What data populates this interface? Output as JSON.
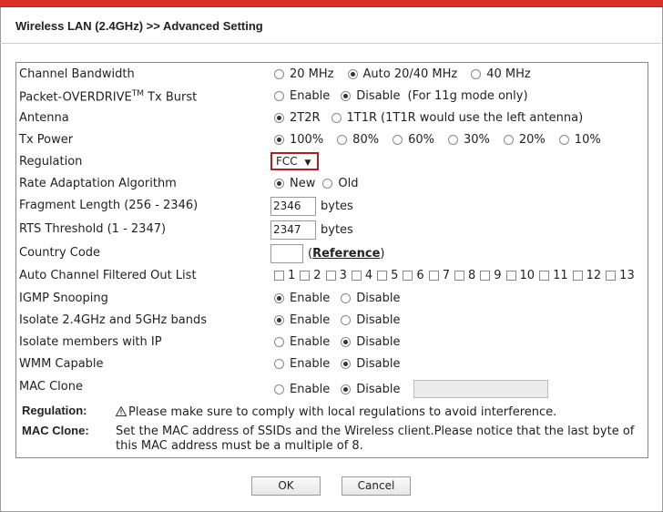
{
  "title": "Wireless LAN (2.4GHz) >> Advanced Setting",
  "rows": {
    "channel_bandwidth": {
      "label": "Channel Bandwidth",
      "options": [
        "20 MHz",
        "Auto 20/40 MHz",
        "40 MHz"
      ],
      "selected": "Auto 20/40 MHz"
    },
    "packet_overdrive": {
      "label_pre": "Packet-OVERDRIVE",
      "label_sup": "TM",
      "label_post": " Tx Burst",
      "options": [
        "Enable",
        "Disable"
      ],
      "selected": "Disable",
      "note": "(For 11g mode only)"
    },
    "antenna": {
      "label": "Antenna",
      "options": [
        "2T2R",
        "1T1R"
      ],
      "selected": "2T2R",
      "note": "(1T1R would use the left antenna)"
    },
    "tx_power": {
      "label": "Tx Power",
      "options": [
        "100%",
        "80%",
        "60%",
        "30%",
        "20%",
        "10%"
      ],
      "selected": "100%"
    },
    "regulation": {
      "label": "Regulation",
      "value": "FCC",
      "arrow": "▼"
    },
    "rate_adaptation": {
      "label": "Rate Adaptation Algorithm",
      "options": [
        "New",
        "Old"
      ],
      "selected": "New"
    },
    "fragment_length": {
      "label": "Fragment Length (256 - 2346)",
      "value": "2346",
      "unit": "bytes"
    },
    "rts_threshold": {
      "label": "RTS Threshold (1 - 2347)",
      "value": "2347",
      "unit": "bytes"
    },
    "country_code": {
      "label": "Country Code",
      "value": "",
      "link_open": "(",
      "link": "Reference",
      "link_close": ")"
    },
    "auto_channel": {
      "label": "Auto Channel Filtered Out List",
      "channels": [
        "1",
        "2",
        "3",
        "4",
        "5",
        "6",
        "7",
        "8",
        "9",
        "10",
        "11",
        "12",
        "13"
      ]
    },
    "igmp_snooping": {
      "label": "IGMP Snooping",
      "options": [
        "Enable",
        "Disable"
      ],
      "selected": "Enable"
    },
    "isolate_bands": {
      "label": "Isolate 2.4GHz and 5GHz bands",
      "options": [
        "Enable",
        "Disable"
      ],
      "selected": "Enable"
    },
    "isolate_ip": {
      "label": "Isolate members with IP",
      "options": [
        "Enable",
        "Disable"
      ],
      "selected": "Disable"
    },
    "wmm": {
      "label": "WMM Capable",
      "options": [
        "Enable",
        "Disable"
      ],
      "selected": "Disable"
    },
    "mac_clone": {
      "label": "MAC Clone",
      "options": [
        "Enable",
        "Disable"
      ],
      "selected": "Disable",
      "value": ""
    }
  },
  "notes": {
    "regulation_label": "Regulation:",
    "regulation_icon": "warning-icon",
    "regulation_text": "Please make sure to comply with local regulations to avoid interference.",
    "mac_clone_label": "MAC Clone:",
    "mac_clone_text": "Set the MAC address of SSIDs and the Wireless client.Please notice that the last byte of this MAC address must be a multiple of 8."
  },
  "buttons": {
    "ok": "OK",
    "cancel": "Cancel"
  },
  "colors": {
    "accent_bar": "#d8312b",
    "select_border": "#b02020"
  }
}
